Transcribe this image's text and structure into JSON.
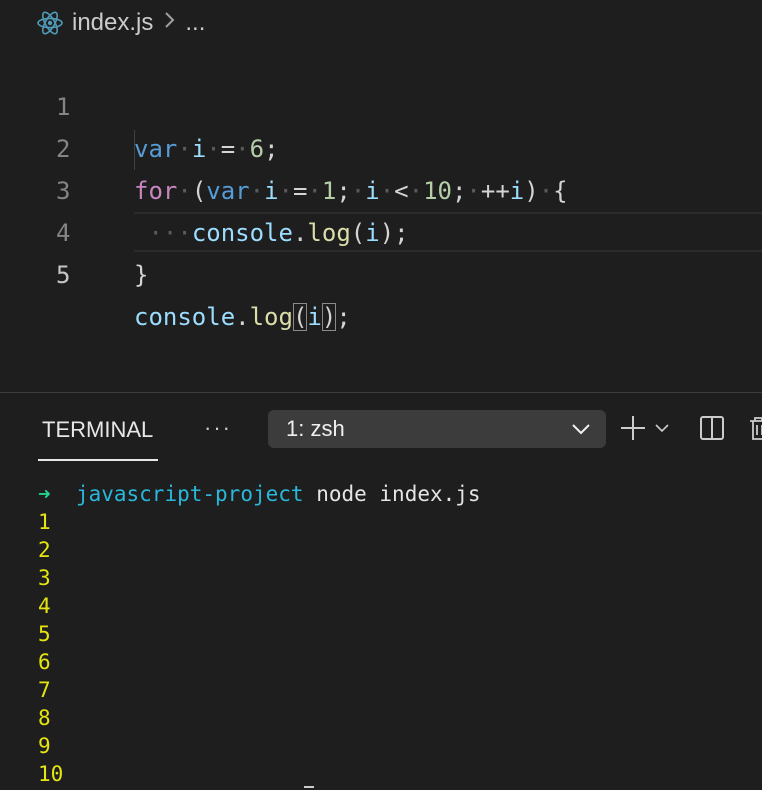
{
  "breadcrumb": {
    "file_icon": "react-icon",
    "file_name": "index.js",
    "separator_icon": "chevron-right-icon",
    "ellipsis": "..."
  },
  "editor": {
    "line_numbers": [
      "1",
      "2",
      "3",
      "4",
      "5"
    ],
    "active_line": "5",
    "lines": [
      "var i = 6;",
      "for (var i = 1; i < 10; ++i) {",
      "    console.log(i);",
      "}",
      "console.log(i);"
    ],
    "tokens": {
      "line1": {
        "kw_var": "var",
        "i": "i",
        "eq": "=",
        "num": "6",
        "semi": ";"
      },
      "line2": {
        "kw_for": "for",
        "paren_open": "(",
        "kw_var": "var",
        "i1": "i",
        "eq": "=",
        "num1": "1",
        "semi1": ";",
        "i2": "i",
        "lt": "<",
        "num2": "10",
        "semi2": ";",
        "incr": "++",
        "i3": "i",
        "paren_close": ")",
        "brace": "{"
      },
      "line3": {
        "dots": "···",
        "console": "console",
        "dot": ".",
        "log": "log",
        "po": "(",
        "i": "i",
        "pc": ")",
        "semi": ";"
      },
      "line4": {
        "brace": "}"
      },
      "line5": {
        "console": "console",
        "dot": ".",
        "log": "log",
        "po": "(",
        "i": "i",
        "pc": ")",
        "semi": ";"
      }
    }
  },
  "panel": {
    "active_tab": "TERMINAL",
    "more_actions_label": "···",
    "shell_selected": "1: zsh",
    "buttons": {
      "new_terminal_icon": "plus-icon",
      "dropdown_icon": "chevron-down-icon",
      "split_icon": "split-terminal-icon",
      "trash_icon": "trash-icon"
    }
  },
  "terminal": {
    "prompt_arrow": "➜",
    "prompt_dir": "javascript-project",
    "command": "node index.js",
    "output": [
      "1",
      "2",
      "3",
      "4",
      "5",
      "6",
      "7",
      "8",
      "9",
      "10"
    ]
  },
  "colors": {
    "background": "#1e1e1e",
    "keyword": "#569cd6",
    "control_keyword": "#c586c0",
    "variable": "#9cdcfe",
    "number": "#b5cea8",
    "function": "#dcdcaa",
    "terminal_output": "#e5e510",
    "prompt_arrow": "#23d18b",
    "prompt_dir": "#29b8db"
  }
}
